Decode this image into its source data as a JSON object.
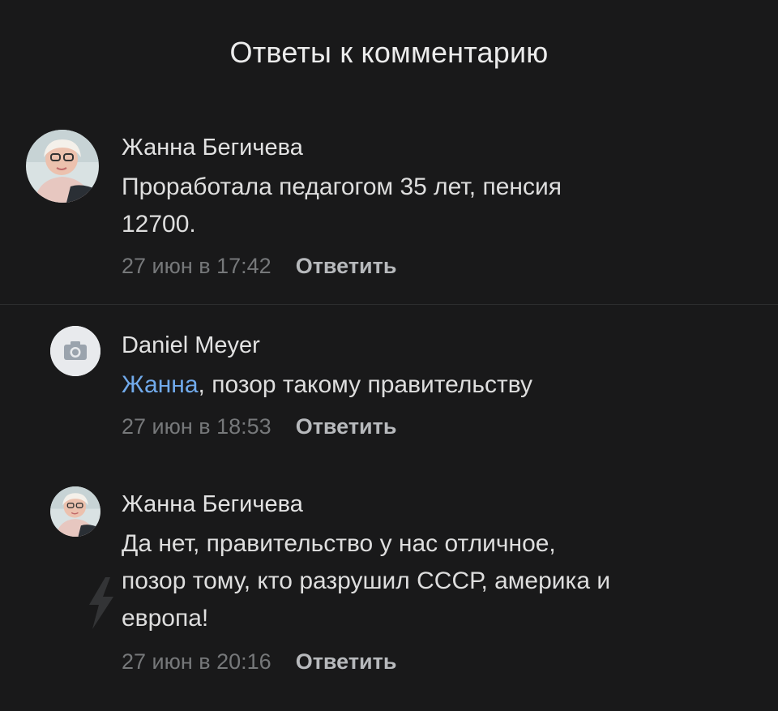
{
  "header": {
    "title": "Ответы к комментарию"
  },
  "comments": [
    {
      "author": "Жанна Бегичева",
      "text_line1": "Проработала педагогом 35 лет, пенсия",
      "text_line2": "12700.",
      "time": "27 июн в 17:42",
      "reply_label": "Ответить"
    },
    {
      "author": "Daniel Meyer",
      "mention": "Жанна",
      "text": ", позор такому правительству",
      "time": "27 июн в 18:53",
      "reply_label": "Ответить"
    },
    {
      "author": "Жанна Бегичева",
      "text_line1": "Да нет, правительство у нас отличное,",
      "text_line2": "позор тому, кто разрушил СССР, америка и",
      "text_line3": "европа!",
      "time": "27 июн в 20:16",
      "reply_label": "Ответить"
    }
  ],
  "colors": {
    "background": "#19191a",
    "mention": "#71aaeb",
    "meta": "#76787a",
    "reply": "#b7b9bc"
  },
  "icons": {
    "no_photo_avatar": "camera-icon",
    "watermark": "lightning-bolt-icon"
  }
}
